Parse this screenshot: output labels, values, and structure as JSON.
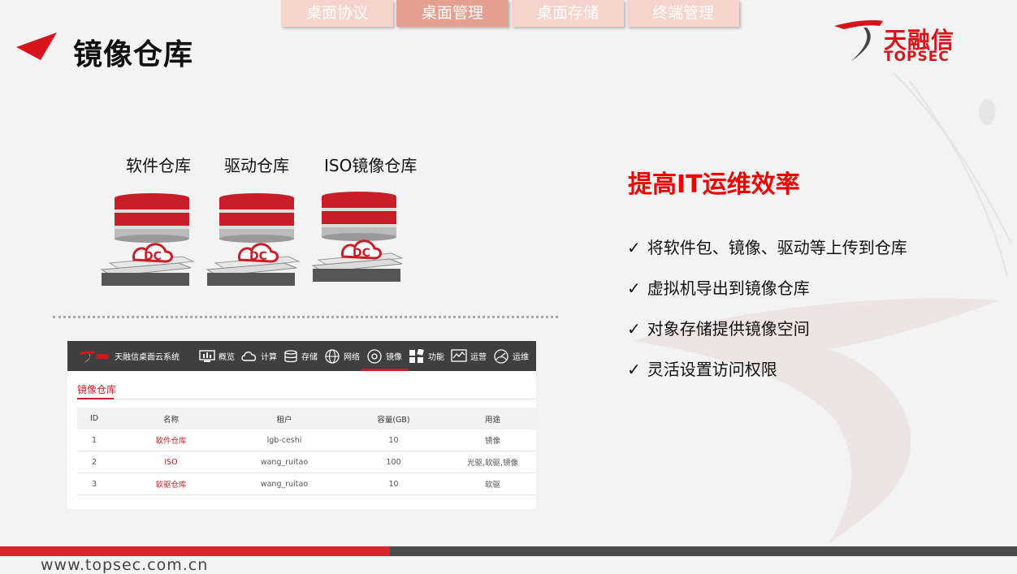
{
  "top_tabs": [
    {
      "label": "桌面协议",
      "active": false
    },
    {
      "label": "桌面管理",
      "active": true
    },
    {
      "label": "桌面存储",
      "active": false
    },
    {
      "label": "终端管理",
      "active": false
    }
  ],
  "title": "镜像仓库",
  "logo": {
    "cn": "天融信",
    "en": "TOPSEC"
  },
  "repos": [
    {
      "label": "软件仓库",
      "badge": "DC"
    },
    {
      "label": "驱动仓库",
      "badge": "DC"
    },
    {
      "label": "ISO镜像仓库",
      "badge": "DC"
    }
  ],
  "app": {
    "name": "天融信桌面云系统",
    "nav": [
      {
        "label": "概览",
        "icon": "monitor-icon"
      },
      {
        "label": "计算",
        "icon": "cloud-icon"
      },
      {
        "label": "存储",
        "icon": "database-icon"
      },
      {
        "label": "网络",
        "icon": "globe-icon"
      },
      {
        "label": "镜像",
        "icon": "disc-icon",
        "active": true
      },
      {
        "label": "功能",
        "icon": "grid-icon"
      },
      {
        "label": "运营",
        "icon": "chart-icon"
      },
      {
        "label": "运维",
        "icon": "gauge-icon"
      }
    ],
    "section_title": "镜像仓库",
    "table": {
      "headers": [
        "ID",
        "名称",
        "租户",
        "容量(GB)",
        "用途"
      ],
      "rows": [
        [
          "1",
          "软件仓库",
          "lgb-ceshi",
          "10",
          "镜像"
        ],
        [
          "2",
          "ISO",
          "wang_ruitao",
          "100",
          "光驱,软驱,镜像"
        ],
        [
          "3",
          "软驱仓库",
          "wang_ruitao",
          "10",
          "软驱"
        ]
      ]
    }
  },
  "right": {
    "title": "提高IT运维效率",
    "bullets": [
      "将软件包、镜像、驱动等上传到仓库",
      "虚拟机导出到镜像仓库",
      "对象存储提供镜像空间",
      "灵活设置访问权限"
    ],
    "check_mark": "✓"
  },
  "footer": {
    "url": "www.topsec.com.cn"
  },
  "colors": {
    "accent": "#d7141a",
    "tab_active": "#e5a08f",
    "tab_inactive": "#f6d4cc"
  }
}
